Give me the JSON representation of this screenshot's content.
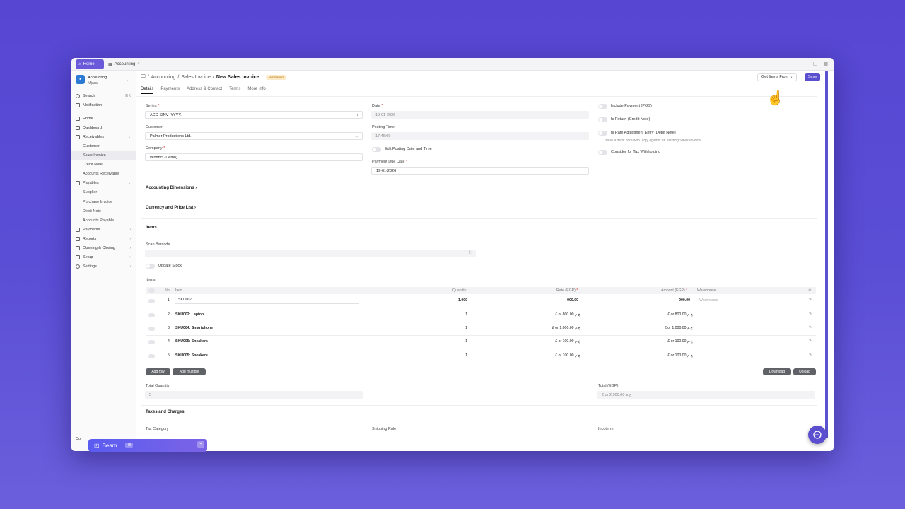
{
  "tabs": {
    "home": "Home",
    "accounting": "Accounting"
  },
  "org": {
    "name_line1": "Accounting",
    "name_line2": "Mjara"
  },
  "sidebar": {
    "items": [
      {
        "label": "Search",
        "kbd": "⌘K"
      },
      {
        "label": "Notification"
      },
      {
        "label": "Home"
      },
      {
        "label": "Dashboard"
      },
      {
        "label": "Receivables"
      },
      {
        "label": "Customer"
      },
      {
        "label": "Sales Invoice"
      },
      {
        "label": "Credit Note"
      },
      {
        "label": "Accounts Receivable"
      },
      {
        "label": "Payables"
      },
      {
        "label": "Supplier"
      },
      {
        "label": "Purchase Invoice"
      },
      {
        "label": "Debit Note"
      },
      {
        "label": "Accounts Payable"
      },
      {
        "label": "Payments"
      },
      {
        "label": "Reports"
      },
      {
        "label": "Opening & Closing"
      },
      {
        "label": "Setup"
      },
      {
        "label": "Settings"
      }
    ],
    "bottom_label": "Co"
  },
  "breadcrumb": {
    "b1": "Accounting",
    "b2": "Sales Invoice",
    "current": "New Sales Invoice",
    "badge": "Not Saved"
  },
  "toolbar": {
    "get_items": "Get Items From",
    "save": "Save"
  },
  "subtabs": [
    "Details",
    "Payments",
    "Address & Contact",
    "Terms",
    "More Info"
  ],
  "form": {
    "series_label": "Series",
    "series_value": "ACC-SINV-.YYYY.-",
    "customer_label": "Customer",
    "customer_value": "Palmer Productions Ltd.",
    "company_label": "Company",
    "company_value": "vconnct (Demo)",
    "date_label": "Date",
    "date_value": "19-01-2026",
    "posting_time_label": "Posting Time",
    "posting_time_value": "17:46:09",
    "edit_posting_label": "Edit Posting Date and Time",
    "due_date_label": "Payment Due Date",
    "due_date_value": "19-01-2026",
    "include_payment": "Include Payment (POS)",
    "is_return": "Is Return (Credit Note)",
    "is_rate_adj": "Is Rate Adjustment Entry (Debit Note)",
    "rate_adj_note": "Issue a debit note with 0 qty against an existing Sales Invoice",
    "tax_withholding": "Consider for Tax Withholding"
  },
  "sections": {
    "accounting_dimensions": "Accounting Dimensions",
    "currency_price": "Currency and Price List",
    "items": "Items",
    "scan_barcode": "Scan Barcode",
    "update_stock": "Update Stock",
    "items_table": "Items",
    "taxes": "Taxes and Charges",
    "tax_category": "Tax Category",
    "shipping_rule": "Shipping Rule",
    "incoterm": "Incoterm"
  },
  "table": {
    "headers": {
      "no": "No.",
      "item": "Item",
      "qty": "Quantity",
      "rate": "Rate (EGP)",
      "amount": "Amount (EGP)",
      "warehouse": "Warehouse"
    },
    "rows": [
      {
        "no": "1",
        "item": "SKU007",
        "qty": "1.000",
        "rate": "900.00",
        "amount": "900.00",
        "warehouse": "Warehouse"
      },
      {
        "no": "2",
        "item": "SKU002: Laptop",
        "qty": "1",
        "rate": "£ or 800.00 ج.م",
        "amount": "£ or 800.00 ج.م",
        "warehouse": ""
      },
      {
        "no": "3",
        "item": "SKU004: Smartphone",
        "qty": "1",
        "rate": "£ or 1,000.00 ج.م",
        "amount": "£ or 1,000.00 ج.م",
        "warehouse": ""
      },
      {
        "no": "4",
        "item": "SKU005: Sneakers",
        "qty": "1",
        "rate": "£ or 100.00 ج.م",
        "amount": "£ or 100.00 ج.م",
        "warehouse": ""
      },
      {
        "no": "5",
        "item": "SKU005: Sneakers",
        "qty": "1",
        "rate": "£ or 100.00 ج.م",
        "amount": "£ or 100.00 ج.م",
        "warehouse": ""
      }
    ],
    "add_row": "Add row",
    "add_multiple": "Add multiple",
    "download": "Download",
    "upload": "Upload"
  },
  "totals": {
    "qty_label": "Total Quantity",
    "qty_value": "5",
    "total_label": "Total (EGP)",
    "total_value": "£ or 2,900.00 ج.م"
  },
  "beam": {
    "label": "Beam",
    "tag": "⌘"
  }
}
